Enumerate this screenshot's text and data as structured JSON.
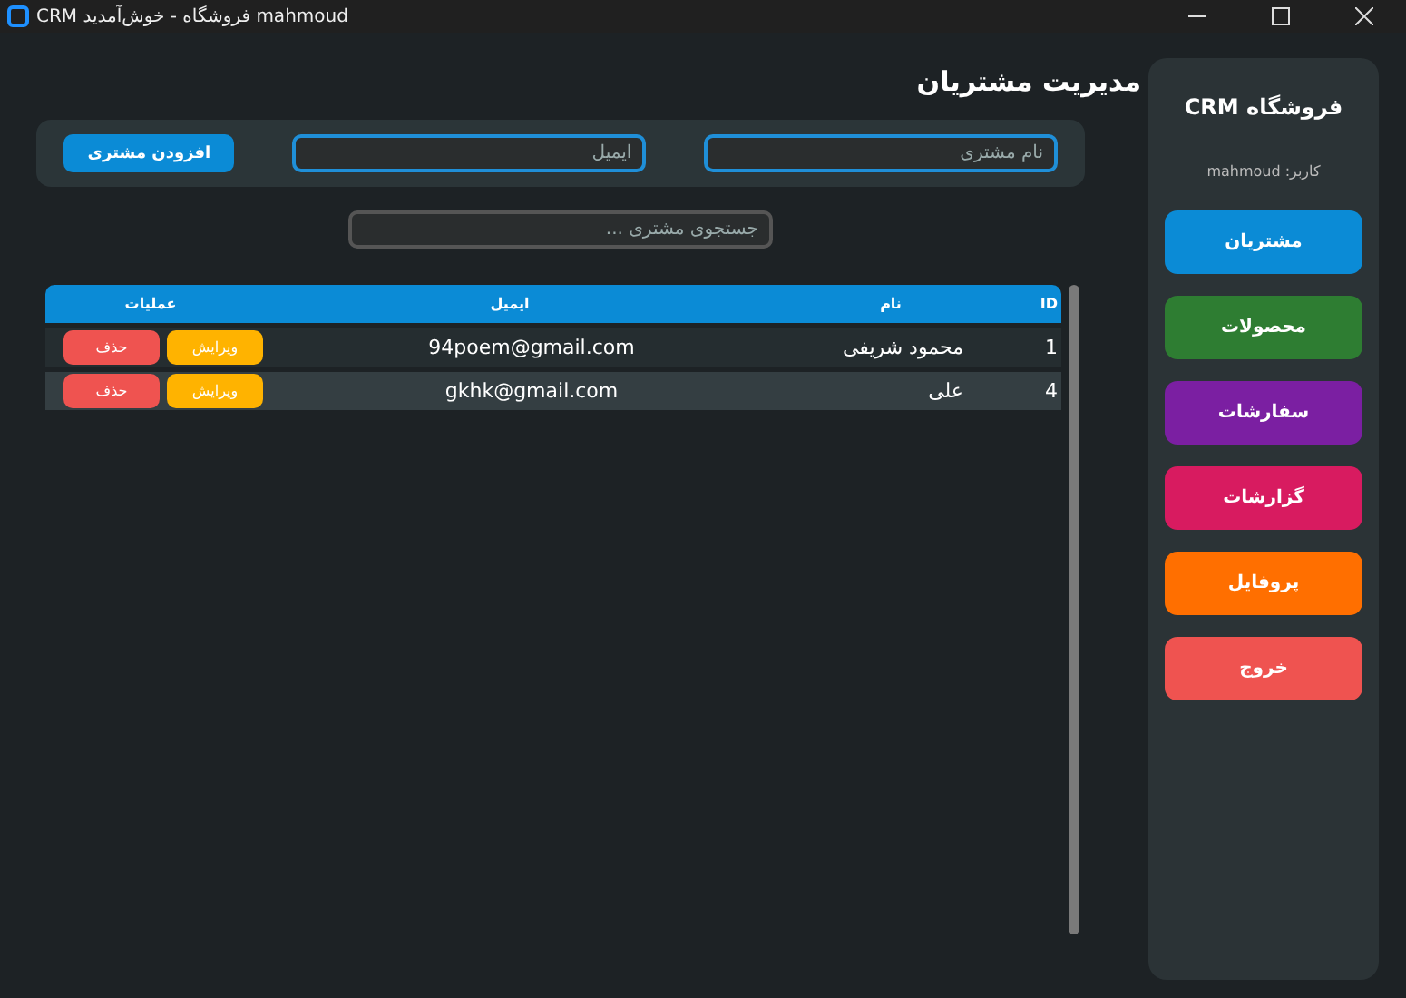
{
  "window": {
    "title": "CRM فروشگاه - خوش‌آمدید mahmoud"
  },
  "sidebar": {
    "title": "فروشگاه CRM",
    "user": "کاربر: mahmoud",
    "items": [
      {
        "label": "مشتریان",
        "color": "#0b8bd6"
      },
      {
        "label": "محصولات",
        "color": "#2e7d32"
      },
      {
        "label": "سفارشات",
        "color": "#7b1fa2"
      },
      {
        "label": "گزارشات",
        "color": "#d81b60"
      },
      {
        "label": "پروفایل",
        "color": "#ff6f00"
      },
      {
        "label": "خروج",
        "color": "#ef5350"
      }
    ]
  },
  "page_title": "مدیریت مشتریان",
  "form": {
    "name_field": {
      "placeholder": "نام مشتری"
    },
    "email_field": {
      "placeholder": "ایمیل"
    },
    "add_button": "افزودن مشتری"
  },
  "search": {
    "placeholder": "جستجوی مشتری ..."
  },
  "table": {
    "columns": [
      "ID",
      "نام",
      "ایمیل",
      "عملیات"
    ],
    "rows": [
      {
        "id": "1",
        "name": "محمود شریفی",
        "email": "94poem@gmail.com",
        "edit": "ویرایش",
        "delete": "حذف"
      },
      {
        "id": "4",
        "name": "علی",
        "email": "gkhk@gmail.com",
        "edit": "ویرایش",
        "delete": "حذف"
      }
    ]
  }
}
